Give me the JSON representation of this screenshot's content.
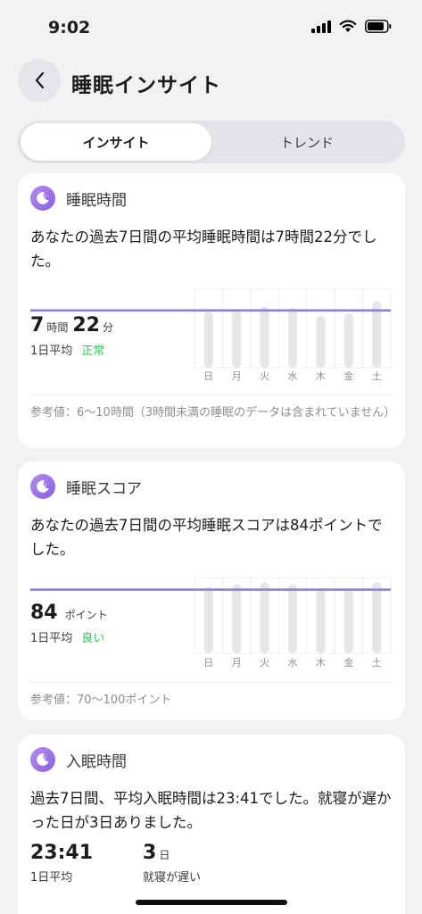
{
  "status_bar": {
    "time": "9:02"
  },
  "header": {
    "title": "睡眠インサイト"
  },
  "tabs": [
    {
      "label": "インサイト"
    },
    {
      "label": "トレンド"
    }
  ],
  "cards": {
    "duration": {
      "title": "睡眠時間",
      "description": "あなたの過去7日間の平均睡眠時間は7時間22分でした。",
      "value_hours": "7",
      "unit_hours": "時間",
      "value_minutes": "22",
      "unit_minutes": "分",
      "avg_label": "1日平均",
      "status": "正常",
      "reference": "参考値：6〜10時間（3時間未満の睡眠のデータは含まれていません）"
    },
    "score": {
      "title": "睡眠スコア",
      "description": "あなたの過去7日間の平均睡眠スコアは84ポイントでした。",
      "value": "84",
      "unit": "ポイント",
      "avg_label": "1日平均",
      "status": "良い",
      "reference": "参考値：70〜100ポイント"
    },
    "bedtime": {
      "title": "入眠時間",
      "description": "過去7日間、平均入眠時間は23:41でした。就寝が遅かった日が3日ありました。",
      "value": "23:41",
      "avg_label": "1日平均",
      "late_count": "3",
      "late_unit": "日",
      "late_label": "就寝が遅い"
    }
  },
  "chart_data": [
    {
      "type": "bar",
      "categories": [
        "日",
        "月",
        "火",
        "水",
        "木",
        "金",
        "土"
      ],
      "values": [
        0.71,
        0.73,
        0.78,
        0.76,
        0.66,
        0.69,
        0.85
      ],
      "average_line": 0.73,
      "title": "",
      "xlabel": "",
      "ylabel": ""
    },
    {
      "type": "bar",
      "categories": [
        "日",
        "月",
        "火",
        "水",
        "木",
        "金",
        "土"
      ],
      "values": [
        0.88,
        0.91,
        0.94,
        0.91,
        0.84,
        0.84,
        0.94
      ],
      "average_line": 0.84,
      "title": "",
      "xlabel": "",
      "ylabel": ""
    }
  ],
  "colors": {
    "accent": "#8c7ce0",
    "good": "#34c759",
    "bar": "#e6e6e9"
  }
}
